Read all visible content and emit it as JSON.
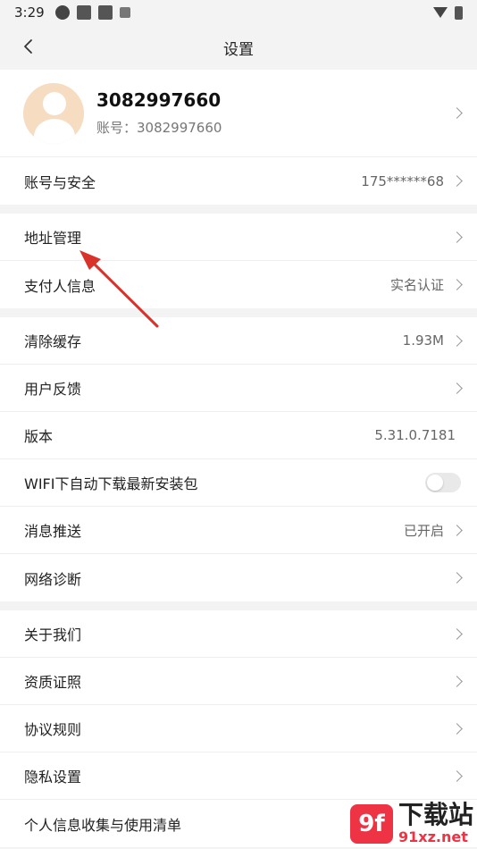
{
  "status_bar": {
    "time": "3:29"
  },
  "header": {
    "title": "设置"
  },
  "profile": {
    "name": "3082997660",
    "account": "账号：3082997660"
  },
  "groups": [
    [
      {
        "label": "账号与安全",
        "value": "175******68",
        "arrow": true
      }
    ],
    [
      {
        "label": "地址管理",
        "value": "",
        "arrow": true
      },
      {
        "label": "支付人信息",
        "value": "实名认证",
        "arrow": true
      }
    ],
    [
      {
        "label": "清除缓存",
        "value": "1.93M",
        "arrow": true
      },
      {
        "label": "用户反馈",
        "value": "",
        "arrow": true
      },
      {
        "label": "版本",
        "value": "5.31.0.7181",
        "arrow": false
      },
      {
        "label": "WIFI下自动下载最新安装包",
        "toggle": false
      },
      {
        "label": "消息推送",
        "value": "已开启",
        "arrow": true
      },
      {
        "label": "网络诊断",
        "value": "",
        "arrow": true
      }
    ],
    [
      {
        "label": "关于我们",
        "value": "",
        "arrow": true
      },
      {
        "label": "资质证照",
        "value": "",
        "arrow": true
      },
      {
        "label": "协议规则",
        "value": "",
        "arrow": true
      },
      {
        "label": "隐私设置",
        "value": "",
        "arrow": true
      },
      {
        "label": "个人信息收集与使用清单",
        "value": "",
        "arrow": false
      }
    ]
  ],
  "watermark": {
    "logo": "9f",
    "title": "下载站",
    "url": "91xz.net"
  },
  "colors": {
    "annotation_arrow": "#d9322b",
    "avatar_bg": "#f6dcc0"
  }
}
